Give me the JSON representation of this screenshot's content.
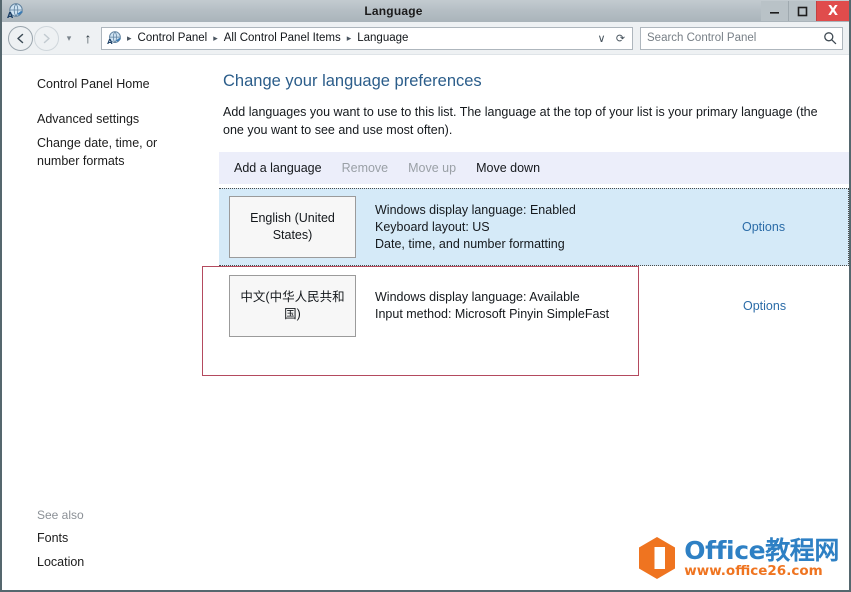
{
  "window": {
    "title": "Language",
    "icon": "language-control-panel-icon",
    "buttons": {
      "minimize": "–",
      "maximize": "☐",
      "close": "X"
    }
  },
  "addressbar": {
    "back": "back-arrow",
    "forward": "forward-arrow",
    "recent_caret": "▾",
    "up": "↑",
    "breadcrumb": {
      "icon": "language-control-panel-icon",
      "separator": "▸",
      "items": [
        "Control Panel",
        "All Control Panel Items",
        "Language"
      ],
      "dropdown": "∨",
      "refresh": "⟳"
    },
    "search": {
      "placeholder": "Search Control Panel",
      "value": "",
      "icon": "search-icon"
    }
  },
  "sidebar": {
    "items": [
      {
        "label": "Control Panel Home"
      },
      {
        "label": "Advanced settings"
      },
      {
        "label": "Change date, time, or number formats"
      }
    ],
    "see_also": {
      "title": "See also",
      "items": [
        {
          "label": "Fonts"
        },
        {
          "label": "Location"
        }
      ]
    }
  },
  "main": {
    "title": "Change your language preferences",
    "description": "Add languages you want to use to this list. The language at the top of your list is your primary language (the one you want to see and use most often).",
    "toolbar": [
      {
        "label": "Add a language",
        "enabled": true
      },
      {
        "label": "Remove",
        "enabled": false
      },
      {
        "label": "Move up",
        "enabled": false
      },
      {
        "label": "Move down",
        "enabled": true
      }
    ],
    "languages": [
      {
        "name": "English (United States)",
        "selected": true,
        "details": [
          "Windows display language: Enabled",
          "Keyboard layout: US",
          "Date, time, and number formatting"
        ],
        "options_label": "Options"
      },
      {
        "name": "中文(中华人民共和国)",
        "selected": false,
        "details": [
          "Windows display language: Available",
          "Input method: Microsoft Pinyin SimpleFast"
        ],
        "options_label": "Options"
      }
    ]
  },
  "annotation": {
    "shape": "rectangle",
    "color": "#b44a5e"
  },
  "watermark": {
    "title": "Office教程网",
    "url": "www.office26.com",
    "logo": "office-hexagon-logo",
    "colors": {
      "title": "#2e80c4",
      "url": "#ef7420",
      "logo": "#ef7420"
    }
  },
  "colors": {
    "titlebar": "#b6bfc5",
    "close_button": "#e04c4c",
    "accent_link": "#2b6ca8",
    "selected_row": "#d5eaf8",
    "command_bar": "#eceefa"
  }
}
